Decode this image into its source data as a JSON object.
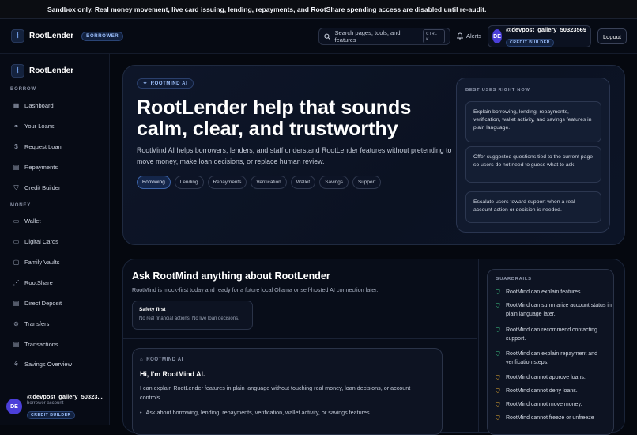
{
  "banner": {
    "text": "Sandbox only. Real money movement, live card issuing, lending, repayments, and RootShare spending access are disabled until re-audit."
  },
  "topbar": {
    "brand": "RootLender",
    "role_badge": "BORROWER",
    "search_placeholder": "Search pages, tools, and features",
    "search_shortcut": "CTRL K",
    "alerts_label": "Alerts",
    "user": {
      "initials": "DE",
      "handle": "@devpost_gallery_50323569",
      "badge": "CREDIT BUILDER"
    },
    "logout_label": "Logout"
  },
  "sidebar": {
    "brand": "RootLender",
    "sections": [
      {
        "title": "BORROW",
        "items": [
          {
            "label": "Dashboard",
            "icon": "grid-icon"
          },
          {
            "label": "Your Loans",
            "icon": "handshake-icon"
          },
          {
            "label": "Request Loan",
            "icon": "dollar-icon"
          },
          {
            "label": "Repayments",
            "icon": "receipt-icon"
          },
          {
            "label": "Credit Builder",
            "icon": "shield-icon"
          }
        ]
      },
      {
        "title": "MONEY",
        "items": [
          {
            "label": "Wallet",
            "icon": "wallet-icon"
          },
          {
            "label": "Digital Cards",
            "icon": "card-icon"
          },
          {
            "label": "Family Vaults",
            "icon": "vault-icon"
          },
          {
            "label": "RootShare",
            "icon": "share-icon"
          },
          {
            "label": "Direct Deposit",
            "icon": "bank-icon"
          },
          {
            "label": "Transfers",
            "icon": "transfer-icon"
          },
          {
            "label": "Transactions",
            "icon": "list-icon"
          },
          {
            "label": "Savings Overview",
            "icon": "piggy-icon"
          }
        ]
      }
    ],
    "user": {
      "initials": "DE",
      "handle": "@devpost_gallery_50323...",
      "subtitle": "borrower account",
      "badge": "CREDIT BUILDER"
    }
  },
  "hero": {
    "chip": "ROOTMIND AI",
    "title": "RootLender help that sounds calm, clear, and trustworthy",
    "description": "RootMind AI helps borrowers, lenders, and staff understand RootLender features without pretending to move money, make loan decisions, or replace human review.",
    "tabs": [
      "Borrowing",
      "Lending",
      "Repayments",
      "Verification",
      "Wallet",
      "Savings",
      "Support"
    ],
    "active_tab": "Borrowing",
    "best_uses": {
      "title": "BEST USES RIGHT NOW",
      "items": [
        "Explain borrowing, lending, repayments, verification, wallet activity, and savings features in plain language.",
        "Offer suggested questions tied to the current page so users do not need to guess what to ask.",
        "Escalate users toward support when a real account action or decision is needed."
      ]
    }
  },
  "ask": {
    "title": "Ask RootMind anything about RootLender",
    "subtitle": "RootMind is mock-first today and ready for a future local Ollama or self-hosted AI connection later.",
    "safety": {
      "title": "Safety first",
      "text": "No real financial actions. No live loan decisions."
    },
    "chat": {
      "label": "ROOTMIND AI",
      "greeting": "Hi, I'm RootMind AI.",
      "text": "I can explain RootLender features in plain language without touching real money, loan decisions, or account controls.",
      "bullet": "Ask about borrowing, lending, repayments, verification, wallet activity, or savings features."
    },
    "guardrails": {
      "title": "GUARDRAILS",
      "items": [
        {
          "text": "RootMind can explain features.",
          "status": "ok"
        },
        {
          "text": "RootMind can summarize account status in plain language later.",
          "status": "ok"
        },
        {
          "text": "RootMind can recommend contacting support.",
          "status": "ok"
        },
        {
          "text": "RootMind can explain repayment and verification steps.",
          "status": "ok"
        },
        {
          "text": "RootMind cannot approve loans.",
          "status": "warn"
        },
        {
          "text": "RootMind cannot deny loans.",
          "status": "warn"
        },
        {
          "text": "RootMind cannot move money.",
          "status": "warn"
        },
        {
          "text": "RootMind cannot freeze or unfreeze",
          "status": "warn"
        }
      ]
    }
  },
  "colors": {
    "accent": "#4b3fd9",
    "ok": "#3fd08a",
    "warn": "#f0b232"
  }
}
